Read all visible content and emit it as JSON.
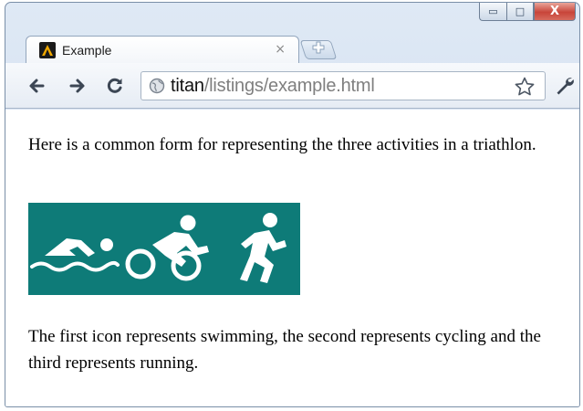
{
  "tab": {
    "title": "Example",
    "close_glyph": "×"
  },
  "window_controls": {
    "minimize": "▭",
    "maximize": "□",
    "close": "X"
  },
  "omnibox": {
    "host": "titan",
    "path": "/listings/example.html"
  },
  "content": {
    "paragraph1": "Here is a common form for representing the three activities in a triathlon.",
    "paragraph2": "The first icon represents swimming, the second represents cycling and the third represents running.",
    "image": {
      "background": "#0e7b78",
      "icons": [
        "swimming-icon",
        "cycling-icon",
        "running-icon"
      ]
    }
  },
  "icons": {
    "favicon": "favicon-icon",
    "new_tab": "new-tab-icon",
    "back": "back-arrow-icon",
    "forward": "forward-arrow-icon",
    "reload": "reload-icon",
    "page_info": "globe-icon",
    "bookmark": "star-icon",
    "menu": "wrench-icon"
  }
}
